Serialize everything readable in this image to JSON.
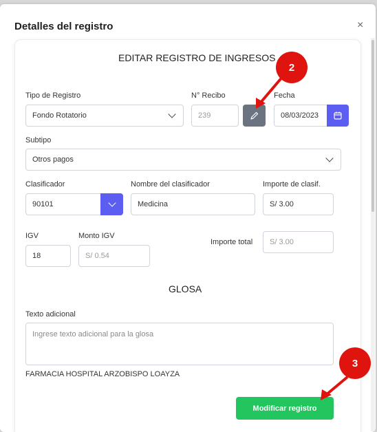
{
  "modal": {
    "title": "Detalles del registro",
    "close_glyph": "×"
  },
  "form": {
    "heading": "EDITAR REGISTRO DE INGRESOS",
    "tipo_registro": {
      "label": "Tipo de Registro",
      "value": "Fondo Rotatorio"
    },
    "recibo": {
      "label": "N° Recibo",
      "value": "239"
    },
    "fecha": {
      "label": "Fecha",
      "value": "08/03/2023"
    },
    "subtipo": {
      "label": "Subtipo",
      "value": "Otros pagos"
    },
    "clasificador": {
      "label": "Clasificador",
      "value": "90101"
    },
    "nombre_clasificador": {
      "label": "Nombre del clasificador",
      "value": "Medicina"
    },
    "importe_clasif": {
      "label": "Importe de clasif.",
      "value": "S/ 3.00"
    },
    "igv": {
      "label": "IGV",
      "value": "18"
    },
    "monto_igv": {
      "label": "Monto IGV",
      "value": "S/ 0.54"
    },
    "importe_total": {
      "label": "Importe total",
      "value": "S/ 3.00"
    },
    "glosa_heading": "GLOSA",
    "texto_adicional": {
      "label": "Texto adicional",
      "placeholder": "Ingrese texto adicional para la glosa"
    },
    "glosa_text": "FARMACIA HOSPITAL ARZOBISPO LOAYZA",
    "submit_label": "Modificar registro"
  },
  "annotations": {
    "marker_2": "2",
    "marker_3": "3"
  },
  "colors": {
    "accent_blue": "#5b5ef0",
    "edit_gray": "#6b7280",
    "submit_green": "#22c55e",
    "marker_red": "#e0140f"
  },
  "icons": [
    "close-icon",
    "chevron-down-icon",
    "pencil-icon",
    "calendar-icon"
  ]
}
